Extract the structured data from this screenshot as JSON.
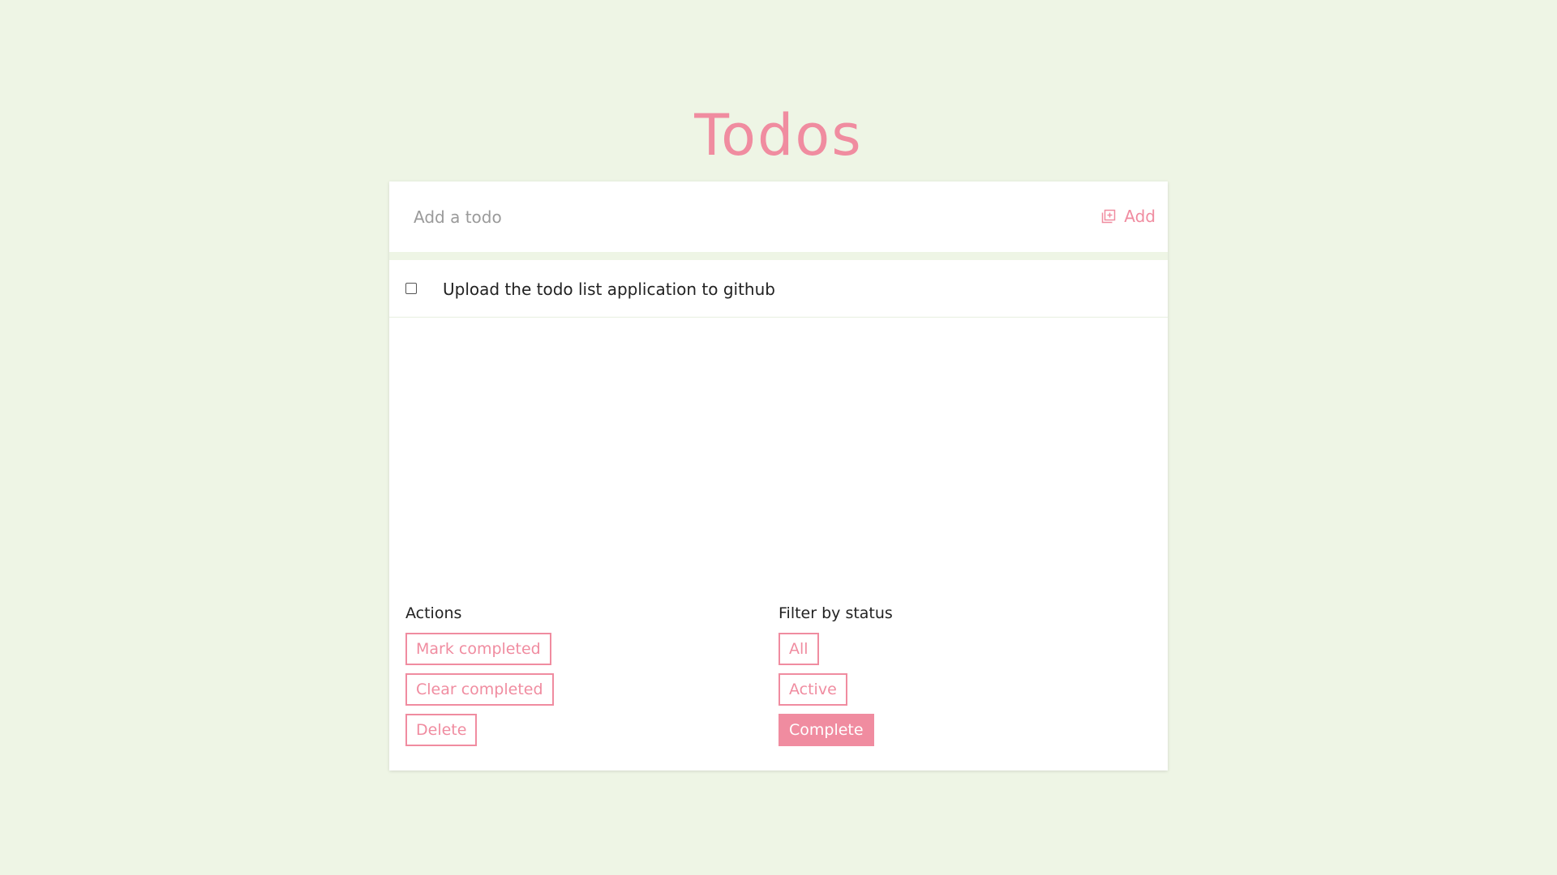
{
  "page": {
    "title": "Todos"
  },
  "add_bar": {
    "placeholder": "Add a todo",
    "input_value": "",
    "add_label": "Add",
    "add_icon": "add-to-list-icon"
  },
  "todos": [
    {
      "text": "Upload the todo list application to github",
      "completed": false
    }
  ],
  "actions": {
    "label": "Actions",
    "buttons": [
      "Mark completed",
      "Clear completed",
      "Delete"
    ]
  },
  "filters": {
    "label": "Filter by status",
    "options": [
      "All",
      "Active",
      "Complete"
    ],
    "selected": "Complete"
  },
  "colors": {
    "background": "#eef5e5",
    "accent": "#f08ca0",
    "surface": "#ffffff"
  }
}
